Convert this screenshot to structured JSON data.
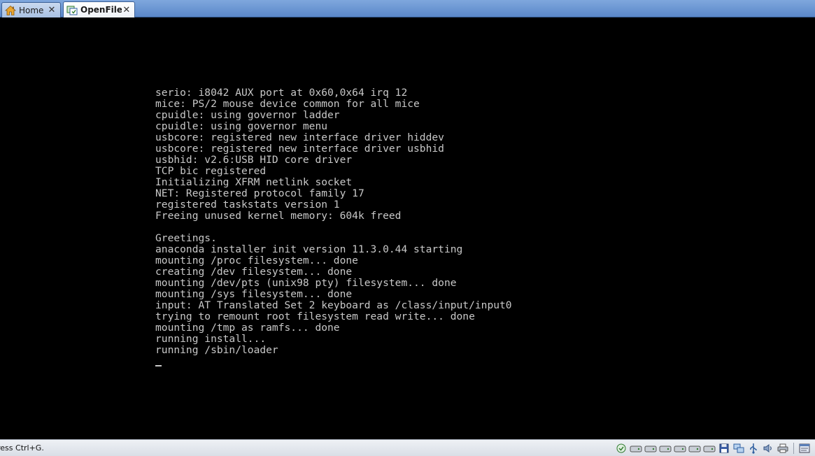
{
  "tabs": [
    {
      "label": "Home",
      "icon": "home-icon",
      "active": false
    },
    {
      "label": "OpenFiler",
      "icon": "vm-icon",
      "active": true
    }
  ],
  "console": {
    "lines": [
      "serio: i8042 AUX port at 0x60,0x64 irq 12",
      "mice: PS/2 mouse device common for all mice",
      "cpuidle: using governor ladder",
      "cpuidle: using governor menu",
      "usbcore: registered new interface driver hiddev",
      "usbcore: registered new interface driver usbhid",
      "usbhid: v2.6:USB HID core driver",
      "TCP bic registered",
      "Initializing XFRM netlink socket",
      "NET: Registered protocol family 17",
      "registered taskstats version 1",
      "Freeing unused kernel memory: 604k freed",
      "",
      "Greetings.",
      "anaconda installer init version 11.3.0.44 starting",
      "mounting /proc filesystem... done",
      "creating /dev filesystem... done",
      "mounting /dev/pts (unix98 pty) filesystem... done",
      "mounting /sys filesystem... done",
      "input: AT Translated Set 2 keyboard as /class/input/input0",
      "trying to remount root filesystem read write... done",
      "mounting /tmp as ramfs... done",
      "running install...",
      "running /sbin/loader"
    ]
  },
  "statusbar": {
    "hint": "ress Ctrl+G."
  },
  "colors": {
    "console_bg": "#000000",
    "console_text": "#c8c8c8",
    "tab_active_bg": "#ffffff",
    "tabbar_bg": "#6e98d4"
  }
}
